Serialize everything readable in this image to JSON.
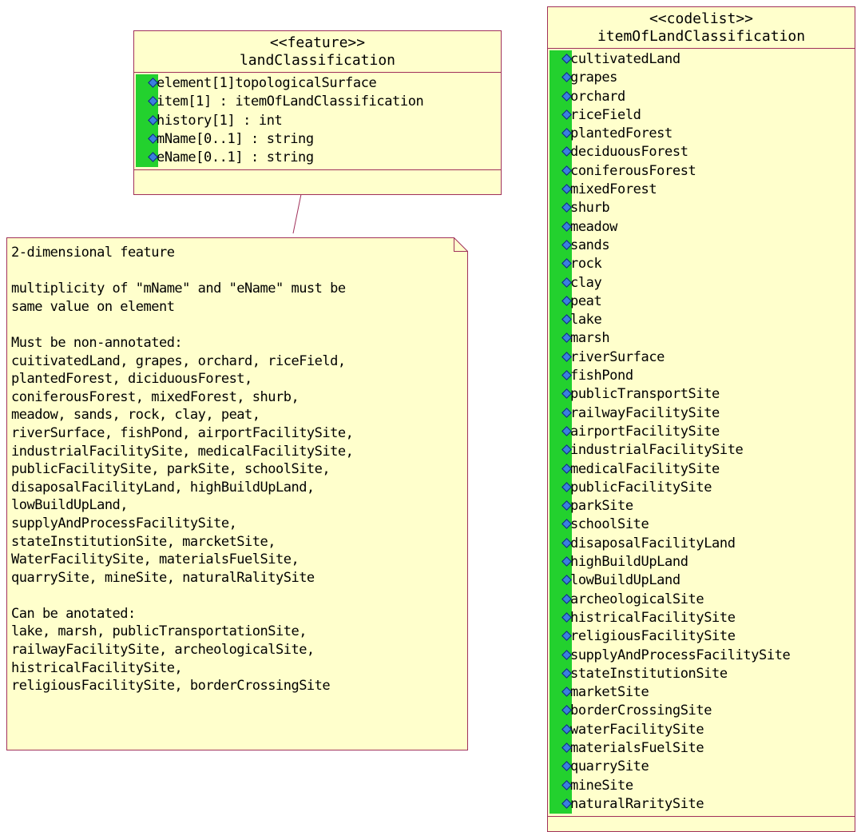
{
  "feature_class": {
    "stereotype": "<<feature>>",
    "name": "landClassification",
    "attributes": [
      "element[1]topologicalSurface",
      "item[1] : itemOfLandClassification",
      "history[1] : int",
      "mName[0..1] : string",
      "eName[0..1] : string"
    ]
  },
  "codelist_class": {
    "stereotype": "<<codelist>>",
    "name": "itemOfLandClassification",
    "attributes": [
      "cultivatedLand",
      "grapes",
      "orchard",
      "riceField",
      "plantedForest",
      "deciduousForest",
      "coniferousForest",
      "mixedForest",
      "shurb",
      "meadow",
      "sands",
      "rock",
      "clay",
      "peat",
      "lake",
      "marsh",
      "riverSurface",
      "fishPond",
      "publicTransportSite",
      "railwayFacilitySite",
      "airportFacilitySite",
      "industrialFacilitySite",
      "medicalFacilitySite",
      "publicFacilitySite",
      "parkSite",
      "schoolSite",
      "disaposalFacilityLand",
      "highBuildUpLand",
      "lowBuildUpLand",
      "archeologicalSite",
      "histricalFacilitySite",
      "religiousFacilitySite",
      "supplyAndProcessFacilitySite",
      "stateInstitutionSite",
      "marketSite",
      "borderCrossingSite",
      "waterFacilitySite",
      "materialsFuelSite",
      "quarrySite",
      "mineSite",
      "naturalRaritySite"
    ]
  },
  "note": {
    "paragraphs": [
      [
        "2-dimensional feature"
      ],
      [
        "multiplicity of \"mName\" and \"eName\" must be",
        "same value on element"
      ],
      [
        "Must be non-annotated:",
        "cuitivatedLand, grapes, orchard, riceField,",
        "plantedForest, diciduousForest,",
        "coniferousForest, mixedForest, shurb,",
        "meadow, sands, rock, clay, peat,",
        "riverSurface, fishPond, airportFacilitySite,",
        "industrialFacilitySite, medicalFacilitySite,",
        "publicFacilitySite, parkSite, schoolSite,",
        "disaposalFacilityLand, highBuildUpLand,",
        "lowBuildUpLand,",
        "supplyAndProcessFacilitySite,",
        "stateInstitutionSite, marcketSite,",
        "WaterFacilitySite, materialsFuelSite,",
        "quarrySite, mineSite, naturalRalitySite"
      ],
      [
        "Can be anotated:",
        "lake, marsh, publicTransportationSite,",
        "railwayFacilitySite, archeologicalSite,",
        "histricalFacilitySite,",
        "religiousFacilitySite, borderCrossingSite"
      ]
    ]
  },
  "colors": {
    "class_fill": "#ffffcc",
    "border": "#a0305a",
    "attribute_strip": "#23d12e",
    "attribute_icon": "#3b7fe0"
  }
}
